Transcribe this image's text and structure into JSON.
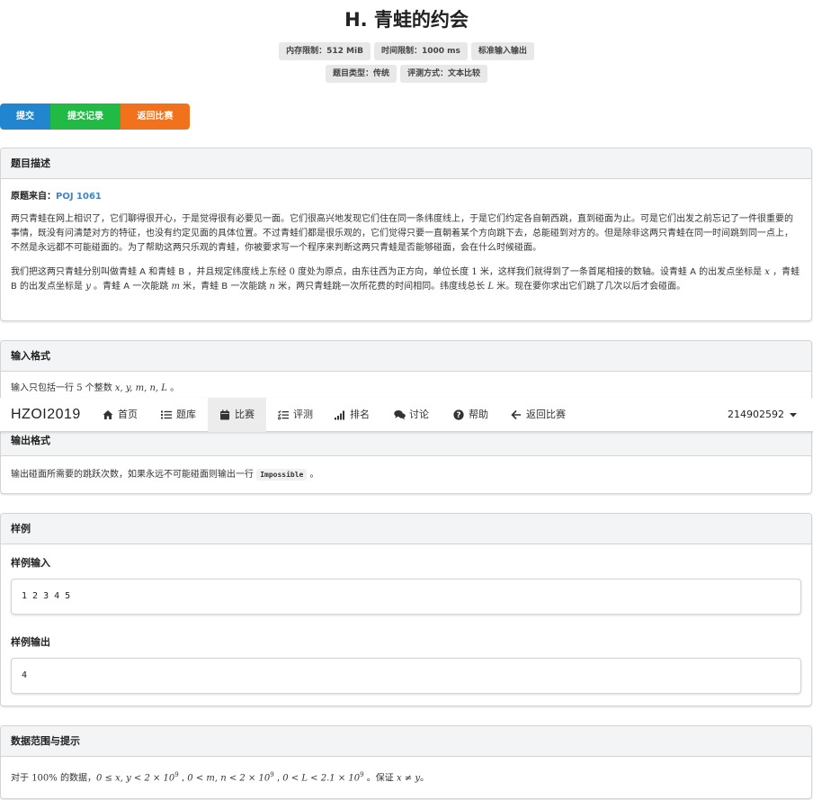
{
  "problem": {
    "title": "H. 青蛙的约会",
    "labels_row1": [
      "内存限制：512 MiB",
      "时间限制：1000 ms",
      "标准输入输出"
    ],
    "labels_row2": [
      "题目类型：传统",
      "评测方式：文本比较"
    ]
  },
  "buttons": {
    "submit": "提交",
    "records": "提交记录",
    "back": "返回比赛"
  },
  "description": {
    "header": "题目描述",
    "source_label": "原题来自：",
    "source_link": "POJ 1061",
    "para1": "两只青蛙在网上相识了，它们聊得很开心，于是觉得很有必要见一面。它们很高兴地发现它们住在同一条纬度线上，于是它们约定各自朝西跳，直到碰面为止。可是它们出发之前忘记了一件很重要的事情，既没有问清楚对方的特征，也没有约定见面的具体位置。不过青蛙们都是很乐观的，它们觉得只要一直朝着某个方向跳下去，总能碰到对方的。但是除非这两只青蛙在同一时间跳到同一点上，不然是永远都不可能碰面的。为了帮助这两只乐观的青蛙，你被要求写一个程序来判断这两只青蛙是否能够碰面，会在什么时候碰面。",
    "para2_a": "我们把这两只青蛙分别叫做青蛙 A 和青蛙 B ，并且规定纬度线上东经 ",
    "para2_zero": "0",
    "para2_b": " 度处为原点，由东往西为正方向，单位长度 ",
    "para2_one": "1",
    "para2_c": " 米，这样我们就得到了一条首尾相接的数轴。设青蛙 A 的出发点坐标是 ",
    "para2_x": "x",
    "para2_d": " ，青蛙 B 的出发点坐标是 ",
    "para2_y": "y",
    "para2_e": " 。青蛙 A 一次能跳 ",
    "para2_m": "m",
    "para2_f": " 米，青蛙 B 一次能跳 ",
    "para2_n": "n",
    "para2_g": " 米，两只青蛙跳一次所花费的时间相同。纬度线总长 ",
    "para2_L": "L",
    "para2_h": " 米。现在要你求出它们跳了几次以后才会碰面。"
  },
  "input_format": {
    "header": "输入格式",
    "text_a": "输入只包括一行 ",
    "count": "5",
    "text_b": " 个整数 ",
    "vars": "x, y, m, n, L",
    "text_c": " 。"
  },
  "navbar": {
    "brand": "HZOI2019",
    "items": [
      {
        "label": "首页",
        "icon": "home-icon"
      },
      {
        "label": "题库",
        "icon": "list-icon"
      },
      {
        "label": "比赛",
        "icon": "calendar-icon"
      },
      {
        "label": "评测",
        "icon": "tasks-icon"
      },
      {
        "label": "排名",
        "icon": "signal-icon"
      },
      {
        "label": "讨论",
        "icon": "comments-icon"
      },
      {
        "label": "帮助",
        "icon": "help-icon"
      },
      {
        "label": "返回比赛",
        "icon": "arrow-left-icon"
      }
    ],
    "user": "214902592"
  },
  "output_format": {
    "header": "输出格式",
    "text_a": "输出碰面所需要的跳跃次数，如果永远不可能碰面则输出一行 ",
    "code": "Impossible",
    "text_b": " 。"
  },
  "samples": {
    "header": "样例",
    "input_title": "样例输入",
    "input_value": "1 2 3 4 5",
    "output_title": "样例输出",
    "output_value": "4"
  },
  "hints": {
    "header": "数据范围与提示",
    "text_a": "对于 ",
    "percent": "100%",
    "text_b": " 的数据，",
    "range1": "0 ≤ x, y < 2 × 10",
    "exp1": "9",
    "sep1": " , ",
    "range2": "0 < m, n < 2 × 10",
    "exp2": "9",
    "sep2": " , ",
    "range3": "0 < L < 2.1 × 10",
    "exp3": "9",
    "text_c": " 。保证 ",
    "neq": "x ≠ y",
    "text_d": "。"
  }
}
